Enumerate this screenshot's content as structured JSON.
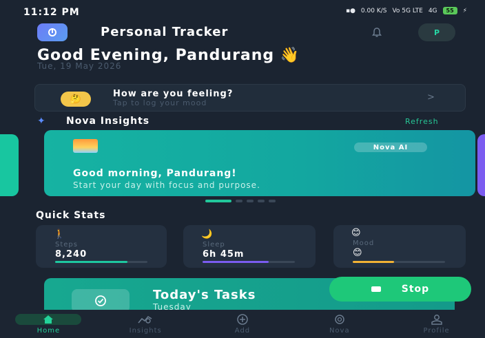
{
  "status_bar": {
    "time": "11:12 PM",
    "net_speed": "0.00 K/S",
    "signal": "Vo 5G LTE",
    "signal2": "4G",
    "battery": "55"
  },
  "header": {
    "title": "Personal Tracker",
    "avatar_initial": "P",
    "greeting": "Good Evening, Pandurang 👋",
    "date": "Tue, 19 May 2026"
  },
  "mood_prompt": {
    "title": "How are you feeling?",
    "subtitle": "Tap to log your mood",
    "chevron": ">"
  },
  "insights": {
    "section_title": "Nova Insights",
    "refresh_label": "Refresh",
    "badge": "Nova AI",
    "headline": "Good morning, Pandurang!",
    "body": "Start your day with focus and purpose."
  },
  "quick_stats": {
    "title": "Quick Stats",
    "items": [
      {
        "label": "Steps",
        "value": "8,240",
        "progress": 0.78,
        "color": "#1ec8a0"
      },
      {
        "label": "Sleep",
        "value": "6h 45m",
        "progress": 0.72,
        "color": "#7b5cf0"
      },
      {
        "label": "Mood",
        "value": "😊",
        "progress": 0.45,
        "color": "#f2b234"
      }
    ]
  },
  "tasks": {
    "title": "Today's Tasks",
    "subtitle": "Tuesday"
  },
  "stop_button": {
    "label": "Stop"
  },
  "nav": {
    "items": [
      {
        "label": "Home",
        "icon": "home-icon",
        "active": true
      },
      {
        "label": "Insights",
        "icon": "insights-icon",
        "active": false
      },
      {
        "label": "Add",
        "icon": "add-icon",
        "active": false
      },
      {
        "label": "Nova",
        "icon": "nova-icon",
        "active": false
      },
      {
        "label": "Profile",
        "icon": "profile-icon",
        "active": false
      }
    ]
  }
}
